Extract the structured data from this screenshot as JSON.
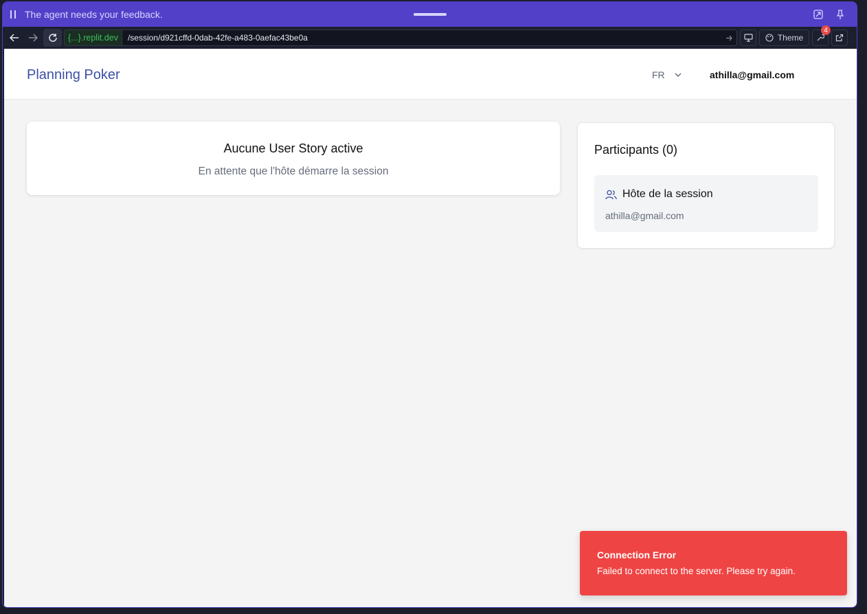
{
  "agent_bar": {
    "message": "The agent needs your feedback.",
    "icons": [
      "pause-icon",
      "drag-handle",
      "popout-icon",
      "pin-icon"
    ]
  },
  "url_bar": {
    "domain": "{...}.replit.dev",
    "path": "/session/d921cffd-0dab-42fe-a483-0aefac43be0a",
    "theme_label": "Theme",
    "devtools_badge": "4",
    "icons": [
      "back-arrow-icon",
      "forward-arrow-icon",
      "reload-icon",
      "go-arrow-icon",
      "monitor-icon",
      "palette-icon",
      "wrench-icon",
      "external-link-icon"
    ]
  },
  "header": {
    "brand": "Planning Poker",
    "language": "FR",
    "user_email": "athilla@gmail.com"
  },
  "story_card": {
    "title": "Aucune User Story active",
    "subtitle": "En attente que l'hôte démarre la session"
  },
  "participants": {
    "title": "Participants (0)",
    "host_label": "Hôte de la session",
    "host_email": "athilla@gmail.com"
  },
  "toast": {
    "title": "Connection Error",
    "message": "Failed to connect to the server. Please try again."
  },
  "colors": {
    "agent_bar": "#5340c9",
    "brand": "#3d4fa6",
    "error": "#ef4444",
    "page_bg": "#f4f4f4"
  }
}
